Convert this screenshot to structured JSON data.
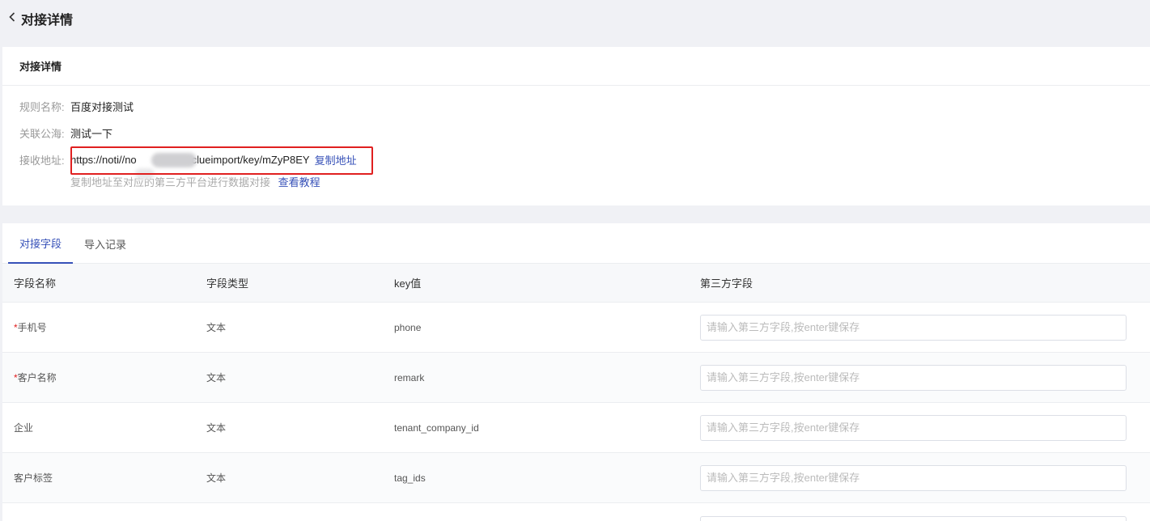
{
  "header": {
    "back_icon": "chevron-left-icon",
    "title": "对接详情"
  },
  "details": {
    "section_title": "对接详情",
    "rule_name_label": "规则名称:",
    "rule_name_value": "百度对接测试",
    "linked_pool_label": "关联公海:",
    "linked_pool_value": "测试一下",
    "address_label": "接收地址:",
    "address_prefix": "https://noti//no",
    "address_suffix": "clueimport/key/mZyP8EY",
    "copy_label": "复制地址",
    "hint_text": "复制地址至对应的第三方平台进行数据对接",
    "tutorial_label": "查看教程",
    "highlight_color": "#e02020"
  },
  "tabs": [
    {
      "label": "对接字段",
      "active": true
    },
    {
      "label": "导入记录",
      "active": false
    }
  ],
  "table": {
    "headers": [
      "字段名称",
      "字段类型",
      "key值",
      "第三方字段"
    ],
    "input_placeholder": "请输入第三方字段,按enter键保存",
    "rows": [
      {
        "required": true,
        "name": "手机号",
        "type": "文本",
        "key": "phone",
        "value": ""
      },
      {
        "required": true,
        "name": "客户名称",
        "type": "文本",
        "key": "remark",
        "value": ""
      },
      {
        "required": false,
        "name": "企业",
        "type": "文本",
        "key": "tenant_company_id",
        "value": ""
      },
      {
        "required": false,
        "name": "客户标签",
        "type": "文本",
        "key": "tag_ids",
        "value": ""
      }
    ]
  },
  "colors": {
    "accent": "#3751b8",
    "required": "#e02020",
    "background": "#f0f1f5"
  }
}
